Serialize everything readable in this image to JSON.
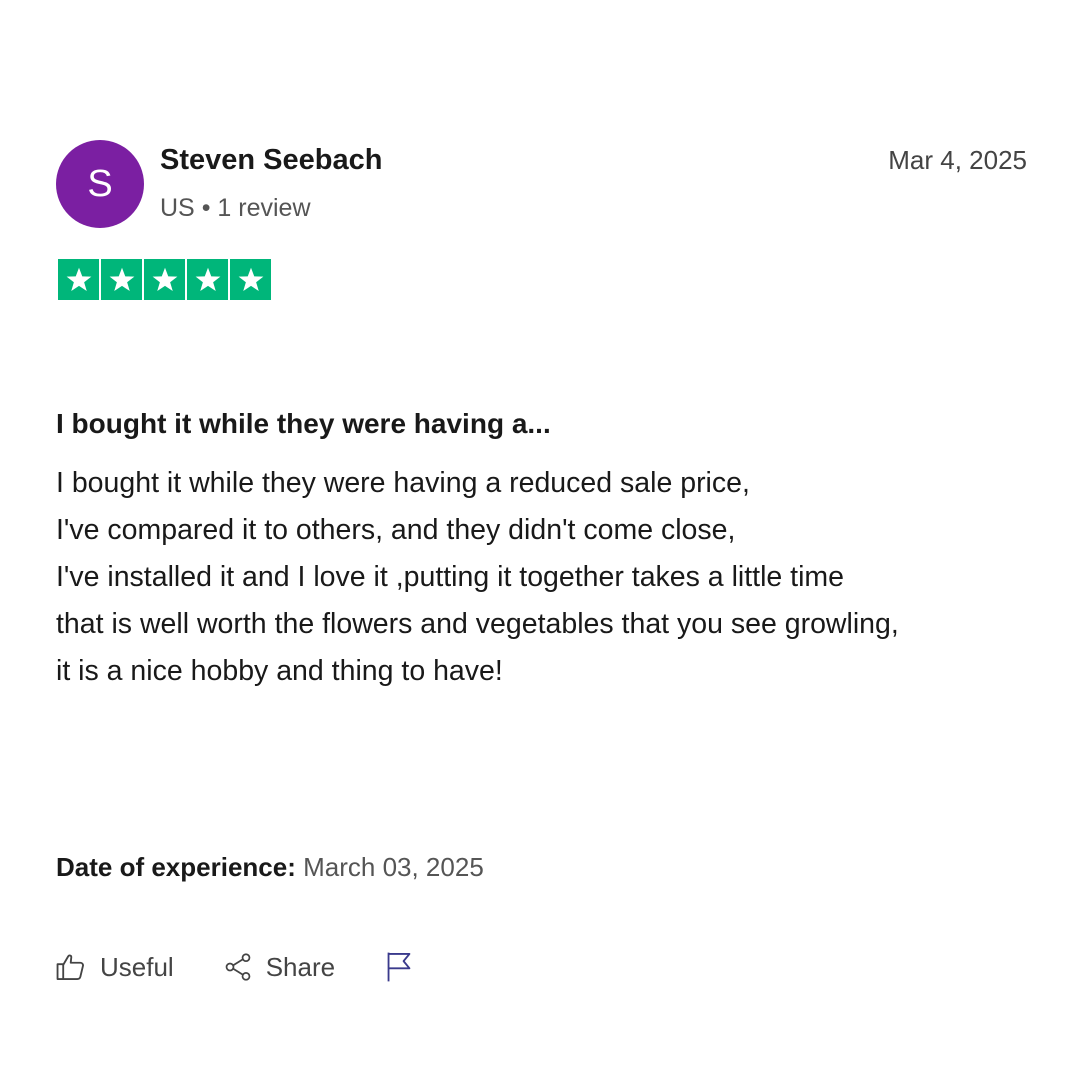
{
  "reviewer": {
    "initial": "S",
    "avatar_color": "#7b1fa2",
    "name": "Steven Seebach",
    "country": "US",
    "separator": "•",
    "review_count": "1 review"
  },
  "review": {
    "date": "Mar 4, 2025",
    "rating": 5,
    "rating_max": 5,
    "star_color": "#00b67a",
    "title": "I bought it while they were having a...",
    "body_lines": [
      "I bought it while they were having a reduced sale price,",
      "I've compared it  to others, and they didn't come close,",
      "I've installed it and I love it ,putting it together takes a little time",
      "that is well worth the flowers and vegetables that you see growling,",
      "it is a nice hobby and thing to have!"
    ],
    "experience_label": "Date of experience:",
    "experience_date": "March 03, 2025"
  },
  "actions": {
    "useful_label": "Useful",
    "useful_icon": "thumbs-up-icon",
    "share_label": "Share",
    "share_icon": "share-icon",
    "report_icon": "flag-icon"
  }
}
